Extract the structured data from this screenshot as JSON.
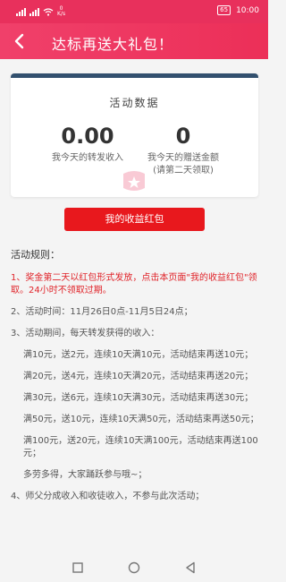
{
  "status_bar": {
    "net_speed_value": "0",
    "net_speed_unit": "K/s",
    "battery": "65",
    "time": "10:00"
  },
  "header": {
    "title": "达标再送大礼包！"
  },
  "card": {
    "title": "活动数据",
    "forward_income_value": "0.00",
    "forward_income_label": "我今天的转发收入",
    "gift_amount_value": "0",
    "gift_amount_label": "我今天的赠送金额",
    "gift_amount_note": "(请第二天领取)"
  },
  "button": {
    "label": "我的收益红包"
  },
  "rules": {
    "heading": "活动规则：",
    "items": [
      "1、奖金第二天以红包形式发放，点击本页面\"我的收益红包\"领取。24小时不领取过期。",
      "2、活动时间：11月26日0点-11月5日24点；",
      "3、活动期间，每天转发获得的收入：",
      "满10元，送2元，连续10天满10元，活动结束再送10元；",
      "满20元，送4元，连续10天满20元，活动结束再送20元；",
      "满30元，送6元，连续10天满30元，活动结束再送30元；",
      "满50元，送10元，连续10天满50元，活动结束再送50元；",
      "满100元，送20元，连续10天满100元，活动结束再送100元；",
      "多劳多得，大家踊跃参与哦~；",
      "4、师父分成收入和收徒收入，不参与此次活动；"
    ]
  },
  "colors": {
    "header": "#ec2f58",
    "button": "#e8181d",
    "highlight_text": "#e0242a",
    "card_top": "#32506e"
  },
  "icons": [
    "signal-icon",
    "wifi-icon",
    "back-arrow-icon",
    "square-nav-icon",
    "circle-nav-icon",
    "triangle-nav-icon"
  ]
}
